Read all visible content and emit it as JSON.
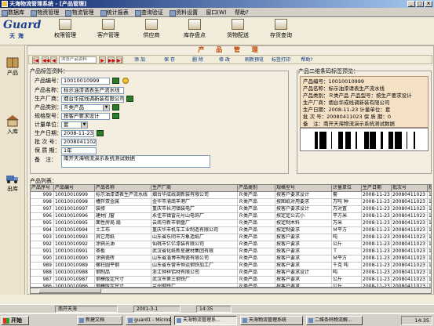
{
  "window": {
    "title": "天海物流管理系统 - [产品管理]"
  },
  "menu": [
    "数据库",
    "物资管理",
    "物流管理",
    "统计报表",
    "查询验证",
    "资料设置",
    "窗口(W)",
    "帮助?"
  ],
  "logo": {
    "text": "Guard",
    "sub": "天海"
  },
  "toolbar": [
    "权限管理",
    "客户管理",
    "供应商",
    "库存盘点",
    "货物配送",
    "存货查询"
  ],
  "sidebar": [
    "产品",
    "入库",
    "出库"
  ],
  "page_title": "产 品 管 理",
  "nav": {
    "record_display": "浏览产品资料",
    "buttons": [
      "添 加",
      "保 存",
      "删 除",
      "修 改",
      "刷新预览",
      "标签打印",
      "帮助?"
    ]
  },
  "form": {
    "group_title": "产品标签资料：",
    "labels": {
      "code": "产品编号：",
      "name": "产品名称：",
      "maker": "生产厂商：",
      "category": "产品类别：",
      "model": "规格型号：",
      "unit": "计量单位：",
      "date": "生产日期：",
      "batch": "批 次 号：",
      "shelf": "保 质 期：",
      "remark": "备　注："
    },
    "values": {
      "code": "10010010999",
      "name": "标示油漆请表生产流水线",
      "maker": "烟台华成线调新装有限公司",
      "category": "Ｒ类产品",
      "model": "按客户要求设计",
      "unit": "套",
      "date": "2008-11-23",
      "batch": "20080411023",
      "shelf": "1年",
      "remark": "南开天海物流演示系统测试数据"
    }
  },
  "label_preview": {
    "group_title": "产品二维条码标签预览：",
    "lines": [
      "产品编号：10010010999",
      "产品名称：标示油漆请表生产流水线",
      "产品类别：Ｒ类产品       产品型号：按生产要求设计",
      "生产厂商：烟台华成线调新装有限公司",
      "生产日期：2008-11-23      计量单位：套",
      "批 次 号：20080411023     保 质 期：0",
      "备　注：南开天海物流演示系统测试数据"
    ]
  },
  "grid": {
    "title": "产品列表：",
    "headers": [
      "产品序号",
      "产品编号",
      "产品名称",
      "生产厂商",
      "产品类别",
      "规格型号",
      "计量单位",
      "生产日期",
      "批次号",
      "质保期"
    ],
    "rows": [
      [
        "999",
        "10010010999",
        "标示油漆请表生产流水线",
        "烟台华成线调新装有限公司",
        "Ｒ类产品",
        "按客户要求设计",
        "套",
        "2008-11-23",
        "20080411023",
        "1年"
      ],
      [
        "998",
        "10010010998",
        "槽拌双金属",
        "金华市渝南丰港厂",
        "Ｒ类产品",
        "按图纸对用要求",
        "万吨 种",
        "2008-11-23",
        "20080411023",
        "1年"
      ],
      [
        "997",
        "10010010997",
        "装修",
        "重庆市长河镇装电厂",
        "Ｒ类产品",
        "按客户要求设计",
        "万对置",
        "2008-11-23",
        "20080411023",
        "1年"
      ],
      [
        "996",
        "10010010996",
        "建材门窗",
        "永佳市镇雷元号山电饰厂",
        "Ｒ类产品",
        "按定定公式小",
        "平方米",
        "2008-11-23",
        "20080411023",
        "1年"
      ],
      [
        "995",
        "10010010995",
        "面性房局 扇",
        "云南马新市钢盘厂",
        "Ｒ类产品",
        "按定制木料",
        "万米",
        "2008-11-23",
        "20080411023",
        "1年"
      ],
      [
        "994",
        "10010010994",
        "土工布",
        "重庆华丰机车工业制造有限公司",
        "Ｒ类产品",
        "按定制要求",
        "Ｍ平方",
        "2008-11-23",
        "20080411023",
        "1年"
      ],
      [
        "993",
        "10010010993",
        "其它用纸",
        "山东省东阴市万象造纸厂",
        "Ｒ类产品",
        "按客户要求",
        "吨",
        "2008-11-23",
        "20080411023",
        "1年"
      ],
      [
        "992",
        "10010010992",
        "涂鸦光油",
        "仙桃市亿亿漆装有限公司",
        "Ｒ类产品",
        "按客户要求",
        "公斤",
        "2008-11-23",
        "20080411023",
        "1年"
      ],
      [
        "991",
        "10010010991",
        "茶板",
        "武汉省化纸新星建材集团有限",
        "Ｒ类产品",
        "按客户要求",
        "Ｔ",
        "2008-11-23",
        "20080411023",
        "1年"
      ],
      [
        "990",
        "10010010990",
        "涂鸦瓷砖",
        "山东省淄博市陶瓷有限公司",
        "Ｒ类产品",
        "按客户要求",
        "Ｍ平方",
        "2008-11-23",
        "20080411023",
        "1年"
      ],
      [
        "989",
        "10010010989",
        "螺柱圆平钢",
        "山东省东营市恒运钢铁加工厂",
        "Ｒ类产品",
        "按客户要求",
        "千克 吨",
        "2008-11-23",
        "20080411023",
        "1年"
      ],
      [
        "988",
        "10010010988",
        "钢制品",
        "浙江钟祥铝材有限公司",
        "Ｒ类产品",
        "按客户要求设计",
        "吨",
        "2008-11-23",
        "20080411023",
        "1年"
      ],
      [
        "987",
        "10010010987",
        "钢模版定尺寸",
        "武汉市第三钢铁厂",
        "Ｒ类产品",
        "按客户要求",
        "公斤",
        "2008-11-23",
        "20080411023",
        "1年"
      ],
      [
        "986",
        "10010010986",
        "钢模版定尺寸",
        "兰州钢铁厂",
        "Ｒ类产品",
        "按客户要求",
        "公斤",
        "2008-11-23",
        "20080411023",
        "1年"
      ]
    ]
  },
  "status": [
    "南开天海",
    "2001-3-1",
    "14:35"
  ],
  "taskbar": {
    "start": "开始",
    "tasks": [
      "新建文档",
      "guard1 - Microsoft...",
      "天海物流管理系...",
      "天海物流管理系统",
      "二维条码物流解..."
    ],
    "clock": "14:35"
  }
}
